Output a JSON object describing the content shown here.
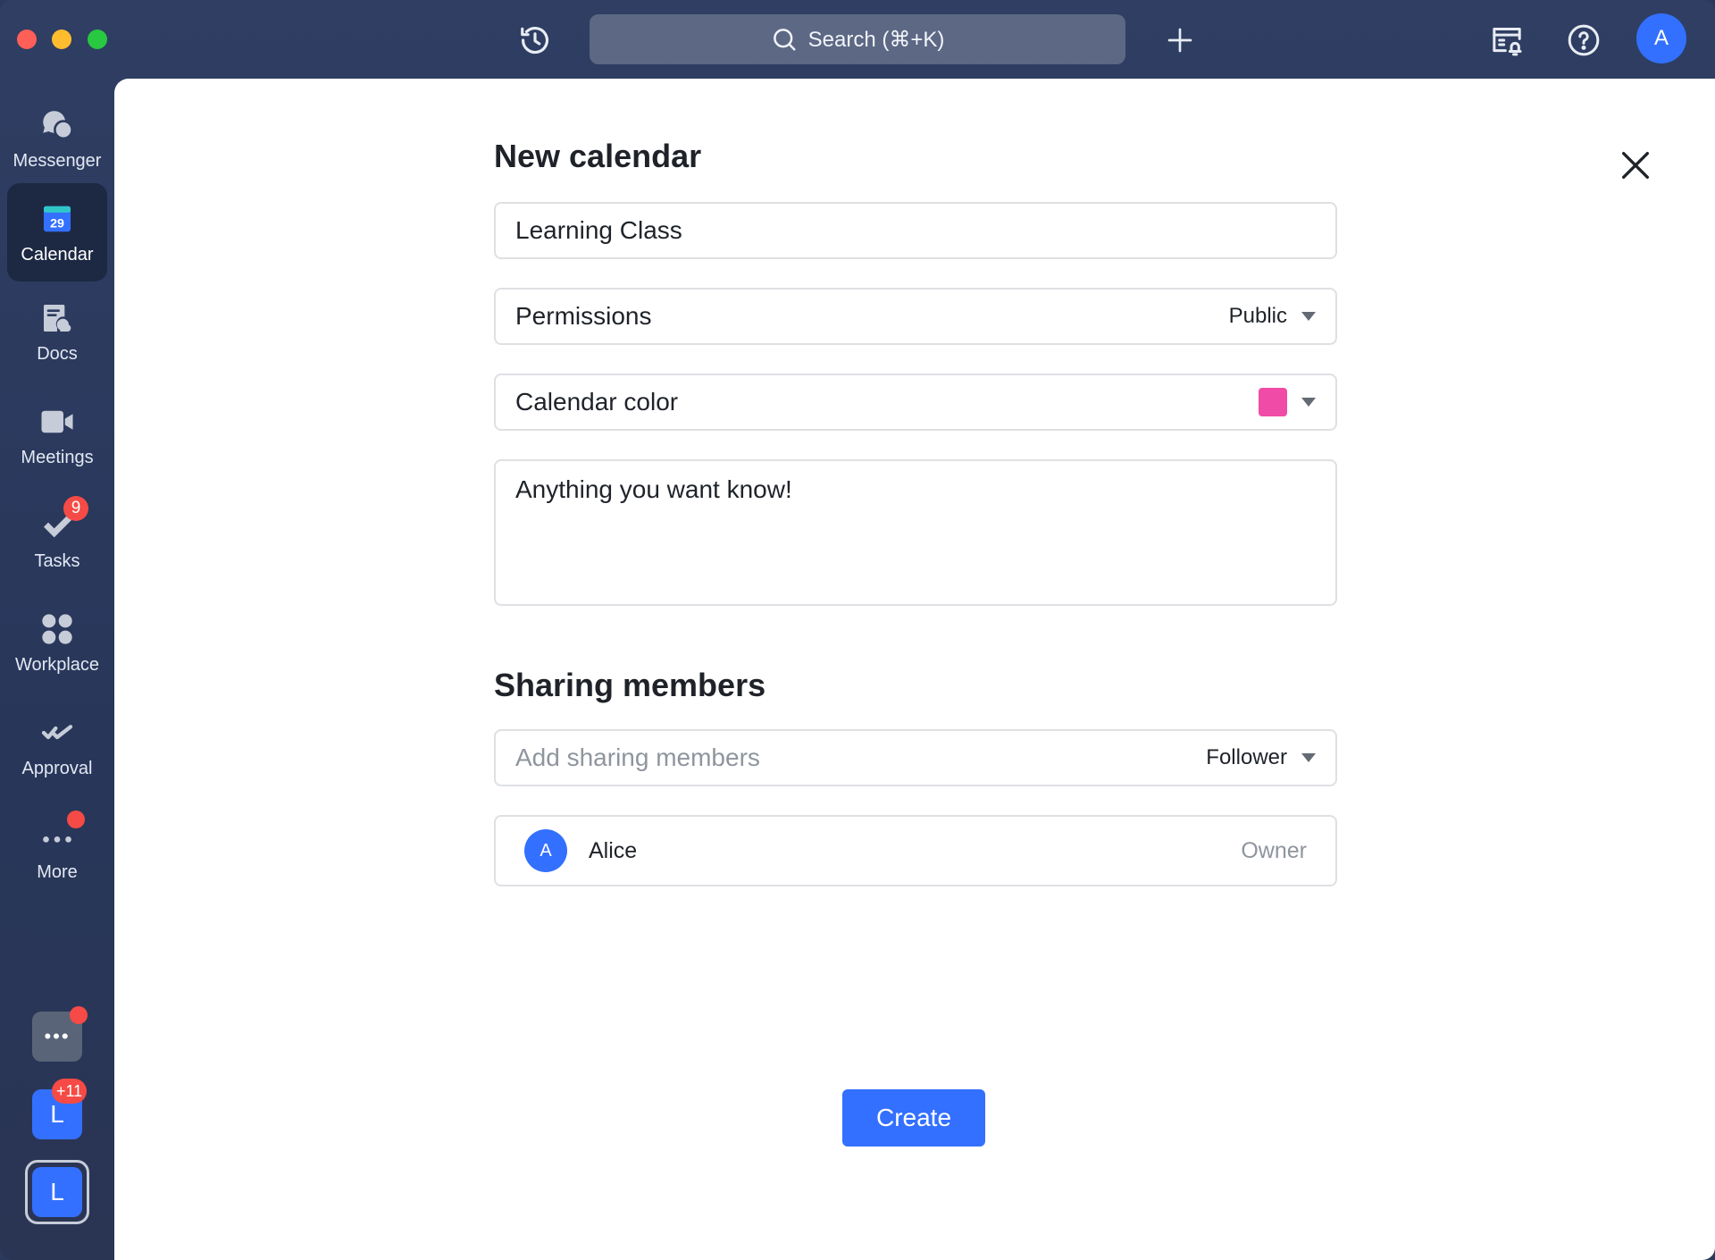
{
  "titlebar": {
    "search_label": "Search (⌘+K)",
    "avatar_initial": "A",
    "icons": [
      "history-icon",
      "search-icon",
      "plus-icon",
      "calendar-alert-icon",
      "help-icon"
    ]
  },
  "sidebar": {
    "items": [
      {
        "label": "Messenger",
        "icon": "messenger-icon"
      },
      {
        "label": "Calendar",
        "icon": "calendar-icon",
        "active": true,
        "date": "29"
      },
      {
        "label": "Docs",
        "icon": "docs-icon"
      },
      {
        "label": "Meetings",
        "icon": "video-icon"
      },
      {
        "label": "Tasks",
        "icon": "tasks-icon",
        "badge": "9"
      },
      {
        "label": "Workplace",
        "icon": "workplace-icon"
      },
      {
        "label": "Approval",
        "icon": "approval-icon"
      },
      {
        "label": "More",
        "icon": "more-icon"
      }
    ],
    "bottom": {
      "more_tile": "•••",
      "tile1_letter": "L",
      "tile1_badge": "+11",
      "tile2_letter": "L"
    }
  },
  "form": {
    "title": "New calendar",
    "name_value": "Learning Class",
    "permissions": {
      "label": "Permissions",
      "value": "Public"
    },
    "calendar_color": {
      "label": "Calendar color",
      "color": "#f04ba6"
    },
    "description": "Anything you want know!",
    "sharing_title": "Sharing members",
    "add_members": {
      "placeholder": "Add sharing members",
      "role": "Follower"
    },
    "members": [
      {
        "initial": "A",
        "name": "Alice",
        "role": "Owner"
      }
    ],
    "create_label": "Create"
  },
  "colors": {
    "accent": "#3370ff",
    "badge": "#f54a45"
  }
}
